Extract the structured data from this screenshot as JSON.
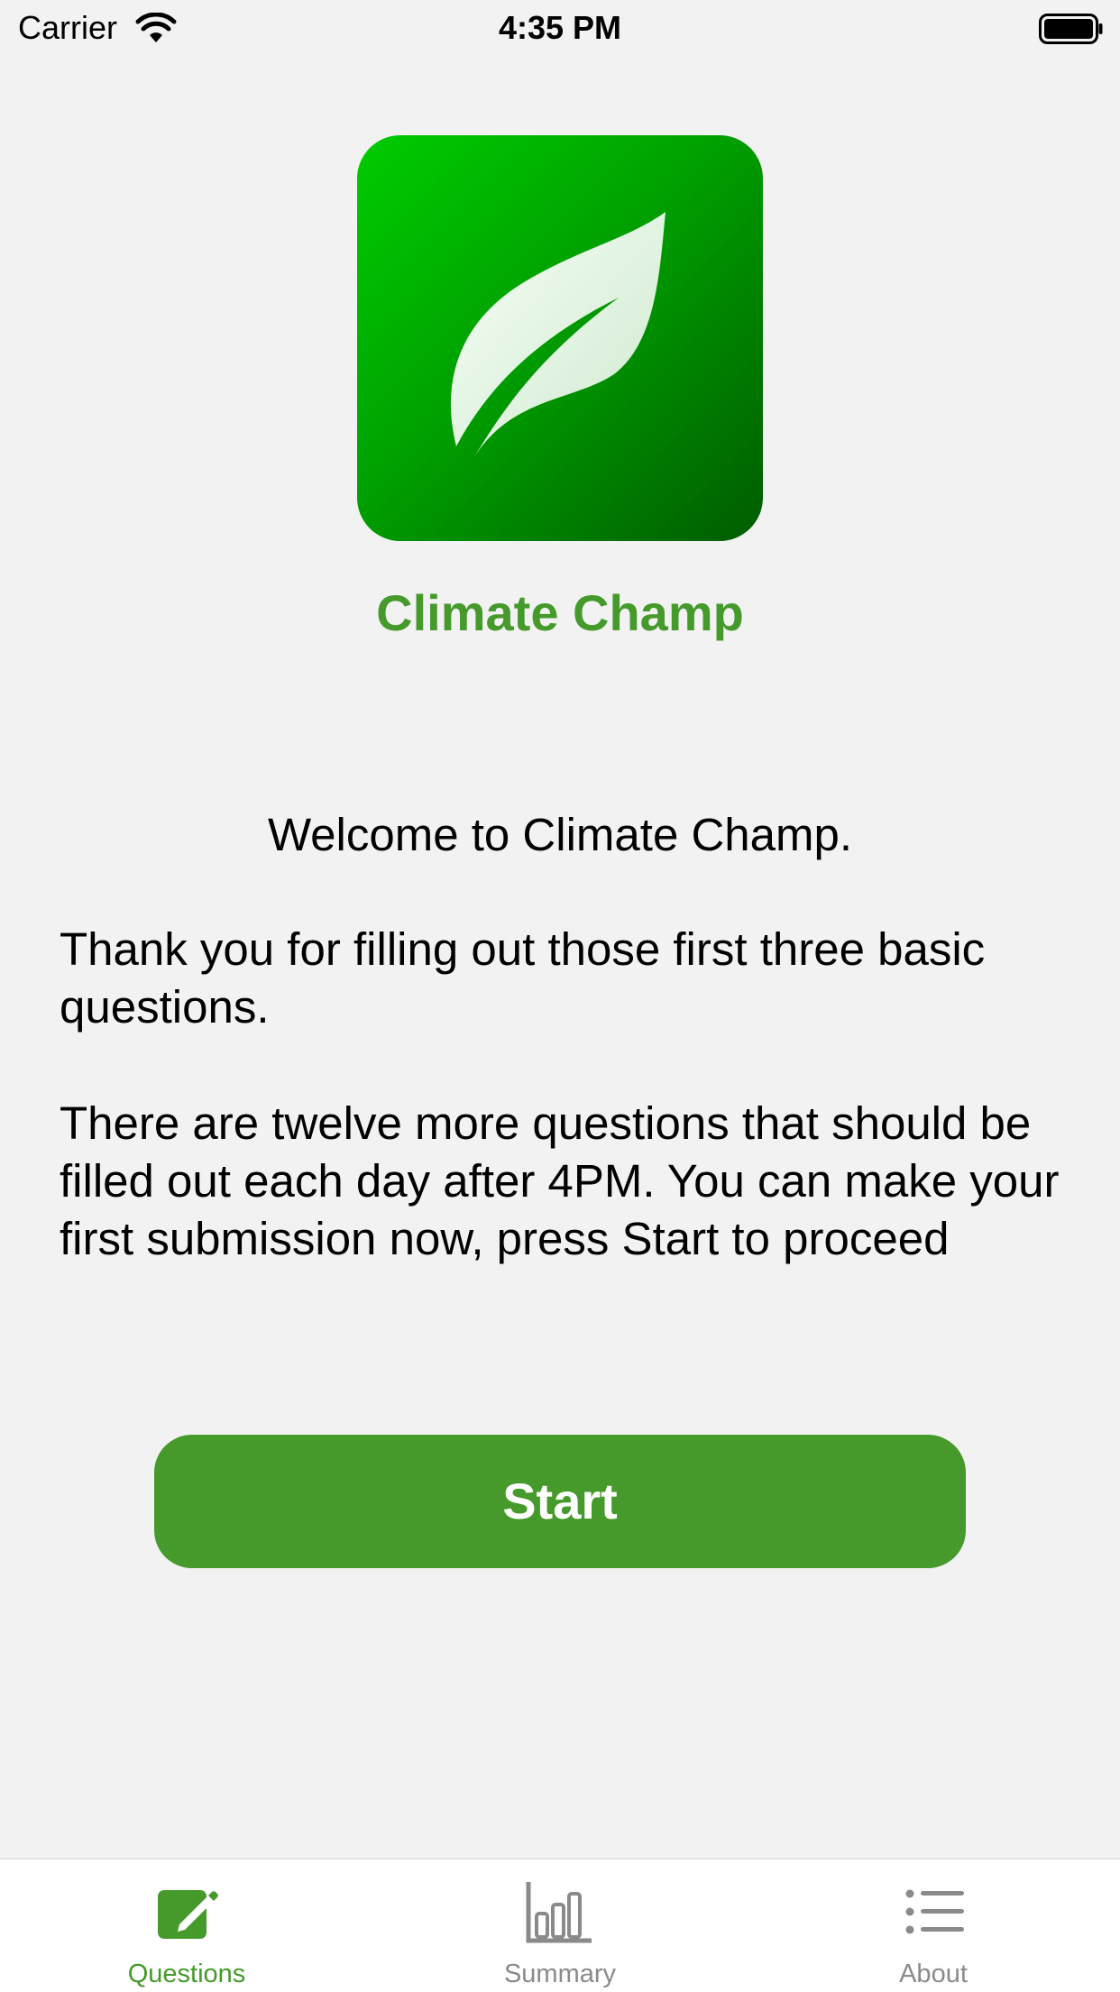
{
  "status_bar": {
    "carrier": "Carrier",
    "time": "4:35 PM"
  },
  "app": {
    "name": "Climate Champ",
    "logo_icon": "leaf-icon",
    "brand_color": "#459a2b"
  },
  "content": {
    "welcome": "Welcome to Climate Champ.",
    "paragraph_1": "Thank you for filling out those first three basic questions.",
    "paragraph_2": "There are twelve more questions that should be filled out each day after 4PM. You can make your first submission now, press Start to proceed"
  },
  "start_button": {
    "label": "Start"
  },
  "tab_bar": {
    "active_color": "#459a2b",
    "inactive_color": "#8a8a8a",
    "tabs": [
      {
        "label": "Questions",
        "icon": "edit-square-icon",
        "active": true
      },
      {
        "label": "Summary",
        "icon": "bar-chart-icon",
        "active": false
      },
      {
        "label": "About",
        "icon": "list-icon",
        "active": false
      }
    ]
  }
}
